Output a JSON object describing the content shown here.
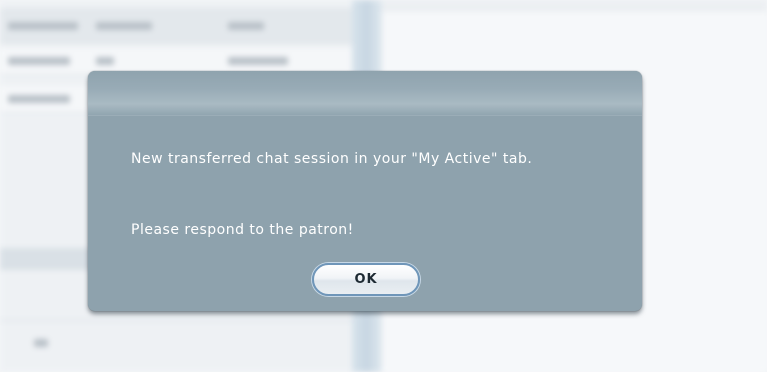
{
  "dialog": {
    "message": "New transferred chat session in your \"My Active\" tab.",
    "prompt": "Please respond to the patron!",
    "ok_label": "OK"
  }
}
